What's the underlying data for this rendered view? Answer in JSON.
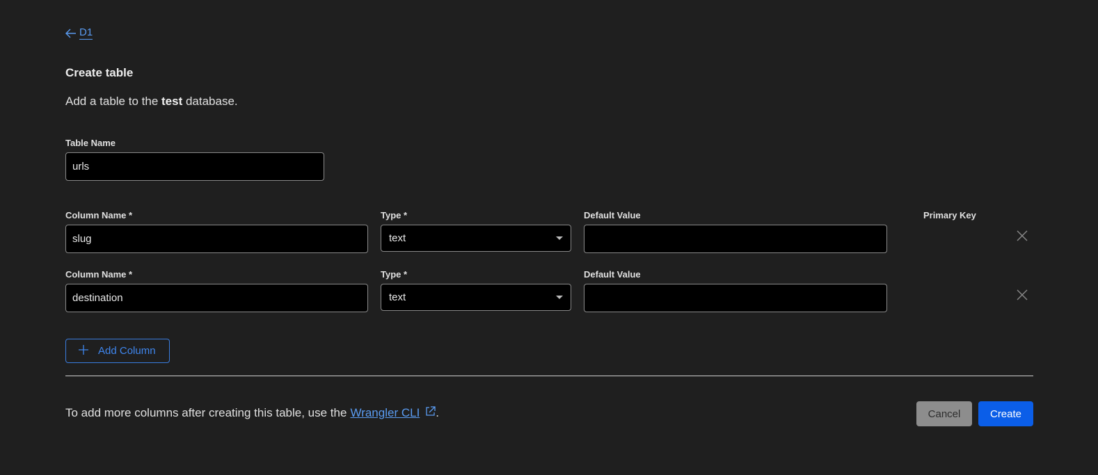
{
  "nav": {
    "back_label": "D1"
  },
  "header": {
    "title": "Create table",
    "subtitle_prefix": "Add a table to the ",
    "database_name": "test",
    "subtitle_suffix": " database."
  },
  "table_name": {
    "label": "Table Name",
    "value": "urls"
  },
  "column_headers": {
    "column_name": "Column Name *",
    "type": "Type *",
    "default_value": "Default Value",
    "primary_key": "Primary Key"
  },
  "columns": [
    {
      "name": "slug",
      "type": "text",
      "default_value": ""
    },
    {
      "name": "destination",
      "type": "text",
      "default_value": ""
    }
  ],
  "add_column_label": "Add Column",
  "footer": {
    "text": "To add more columns after creating this table, use the",
    "link_label": "Wrangler CLI",
    "trailing": ".",
    "cancel_label": "Cancel",
    "create_label": "Create"
  },
  "colors": {
    "background": "#1f1f1f",
    "link": "#5a9cf2",
    "primary": "#0b5ee8",
    "secondary": "#8d8d8d"
  }
}
